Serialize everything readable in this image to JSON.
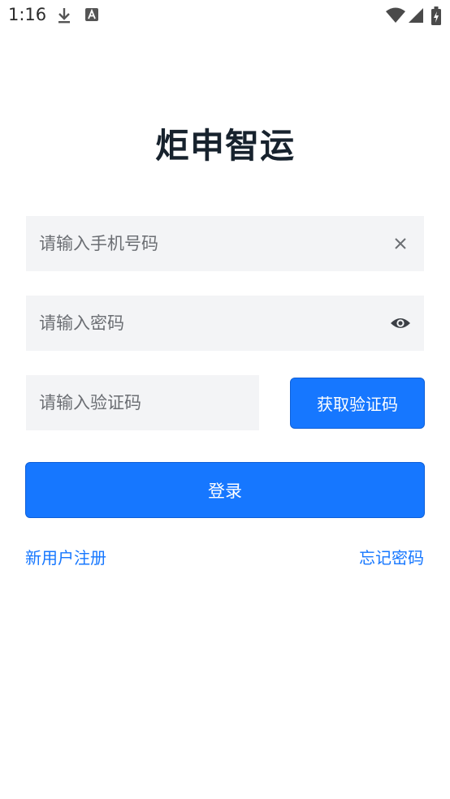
{
  "status_bar": {
    "time": "1:16",
    "icons": [
      "download-icon",
      "a-badge-icon",
      "wifi-icon",
      "signal-icon",
      "battery-charging-icon"
    ]
  },
  "app": {
    "title": "炬申智运"
  },
  "form": {
    "phone_placeholder": "请输入手机号码",
    "password_placeholder": "请输入密码",
    "code_placeholder": "请输入验证码",
    "get_code_label": "获取验证码",
    "login_label": "登录"
  },
  "links": {
    "register": "新用户注册",
    "forgot": "忘记密码"
  },
  "colors": {
    "accent": "#1677ff",
    "input_background": "#f3f4f6",
    "title": "#17222d"
  }
}
